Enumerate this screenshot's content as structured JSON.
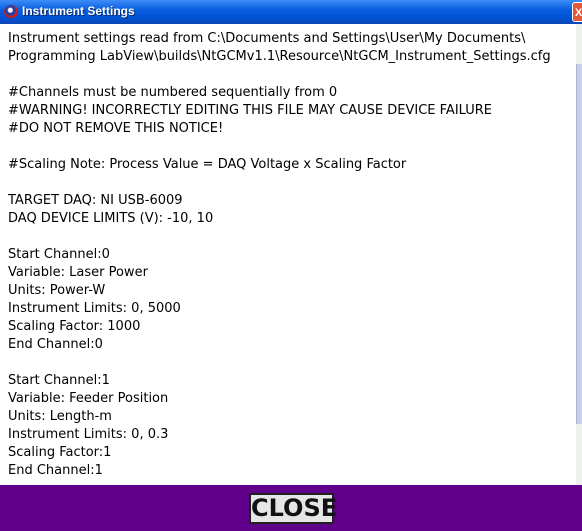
{
  "window": {
    "title": "Instrument Settings",
    "close_glyph": "X"
  },
  "content": {
    "lines": [
      "Instrument settings read from C:\\Documents and Settings\\User\\My Documents\\",
      "Programming LabView\\builds\\NtGCMv1.1\\Resource\\NtGCM_Instrument_Settings.cfg",
      "",
      "#Channels must be numbered sequentially from 0",
      "#WARNING! INCORRECTLY EDITING THIS FILE MAY CAUSE DEVICE FAILURE",
      "#DO NOT REMOVE THIS NOTICE!",
      "",
      "#Scaling Note: Process Value = DAQ Voltage x Scaling Factor",
      "",
      "TARGET DAQ: NI USB-6009",
      "DAQ DEVICE LIMITS (V): -10, 10",
      "",
      "Start Channel:0",
      "Variable: Laser Power",
      "Units: Power-W",
      "Instrument Limits: 0, 5000",
      "Scaling Factor: 1000",
      "End Channel:0",
      "",
      "Start Channel:1",
      "Variable: Feeder Position",
      "Units: Length-m",
      "Instrument Limits: 0, 0.3",
      "Scaling Factor:1",
      "End Channel:1"
    ]
  },
  "footer": {
    "close_label": "CLOSE"
  },
  "colors": {
    "footer_bg": "#60008a",
    "titlebar": "#0a5fe0"
  }
}
